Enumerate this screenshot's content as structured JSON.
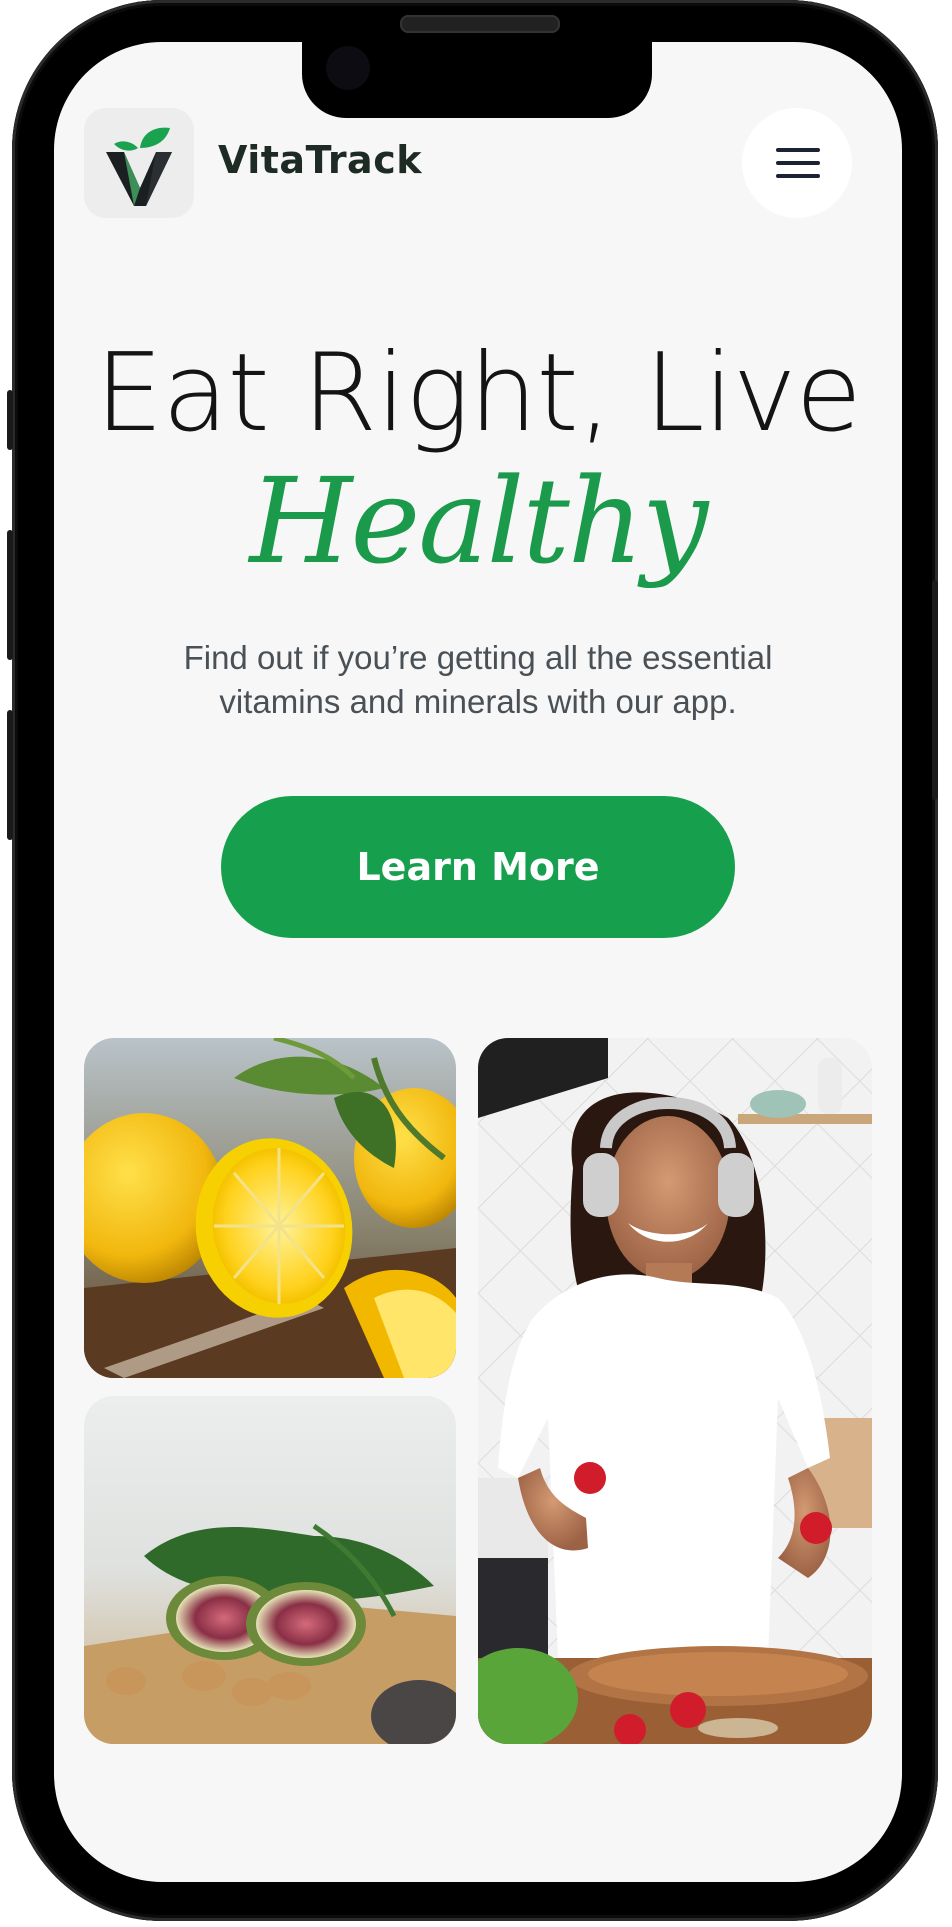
{
  "header": {
    "brand_name": "VitaTrack",
    "logo_icon": "sprout-v-logo-icon",
    "menu_icon": "hamburger-menu-icon"
  },
  "hero": {
    "title_line1": "Eat Right, Live",
    "title_line2": "Healthy",
    "subtitle_line1": "Find out if you’re getting all the essential",
    "subtitle_line2": "vitamins and minerals with our app.",
    "cta_label": "Learn More"
  },
  "gallery": {
    "images": [
      "lemons-photo",
      "figs-walnuts-photo",
      "woman-with-headphones-cooking-photo"
    ]
  },
  "colors": {
    "accent_green": "#16a04d",
    "heading_green": "#1a9a4a",
    "heading_dark": "#141414",
    "background": "#f7f7f7"
  }
}
